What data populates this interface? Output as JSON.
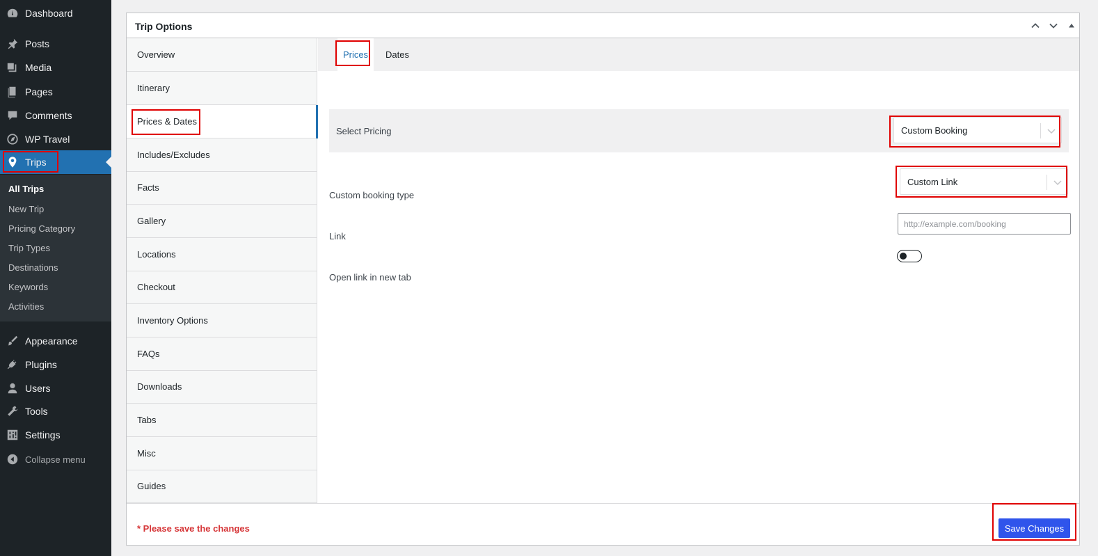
{
  "admin_menu": {
    "items": [
      {
        "label": "Dashboard",
        "icon": "dashboard-icon"
      },
      {
        "label": "Posts",
        "icon": "pin-icon"
      },
      {
        "label": "Media",
        "icon": "media-icon"
      },
      {
        "label": "Pages",
        "icon": "pages-icon"
      },
      {
        "label": "Comments",
        "icon": "comments-icon"
      },
      {
        "label": "WP Travel",
        "icon": "compass-icon"
      },
      {
        "label": "Trips",
        "icon": "location-pin-icon"
      },
      {
        "label": "Appearance",
        "icon": "paintbrush-icon"
      },
      {
        "label": "Plugins",
        "icon": "plug-icon"
      },
      {
        "label": "Users",
        "icon": "user-icon"
      },
      {
        "label": "Tools",
        "icon": "wrench-icon"
      },
      {
        "label": "Settings",
        "icon": "sliders-icon"
      }
    ],
    "current": "Trips",
    "submenu": [
      "All Trips",
      "New Trip",
      "Pricing Category",
      "Trip Types",
      "Destinations",
      "Keywords",
      "Activities"
    ],
    "submenu_current": "All Trips",
    "collapse_label": "Collapse menu"
  },
  "metabox": {
    "title": "Trip Options",
    "left_tabs": [
      "Overview",
      "Itinerary",
      "Prices & Dates",
      "Includes/Excludes",
      "Facts",
      "Gallery",
      "Locations",
      "Checkout",
      "Inventory Options",
      "FAQs",
      "Downloads",
      "Tabs",
      "Misc",
      "Guides"
    ],
    "active_left_tab": "Prices & Dates",
    "sub_tabs": [
      "Prices",
      "Dates"
    ],
    "active_sub_tab": "Prices",
    "fields": {
      "select_pricing": {
        "label": "Select Pricing",
        "value": "Custom Booking"
      },
      "custom_booking_type": {
        "label": "Custom booking type",
        "value": "Custom Link"
      },
      "link": {
        "label": "Link",
        "value": "",
        "placeholder": "http://example.com/booking"
      },
      "open_new_tab": {
        "label": "Open link in new tab",
        "checked": false
      }
    },
    "footer": {
      "note": "* Please save the changes",
      "save_label": "Save Changes"
    }
  },
  "colors": {
    "sidebar_bg": "#1d2327",
    "accent": "#2271b1",
    "save_button": "#2f54eb",
    "warning_text": "#d63638",
    "annotation": "#e00000"
  }
}
